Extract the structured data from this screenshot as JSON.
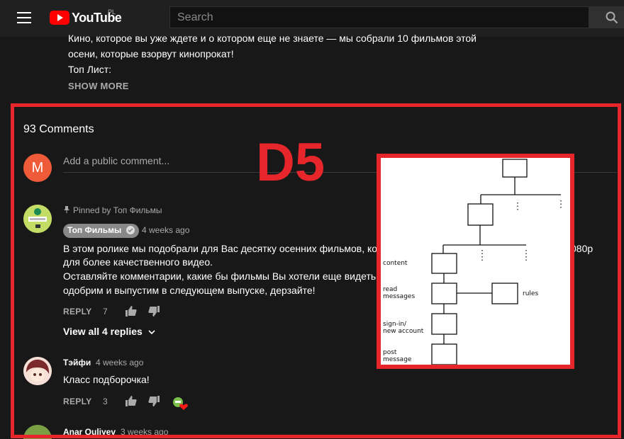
{
  "header": {
    "logo_text": "YouTube",
    "logo_region": "PL",
    "search_placeholder": "Search"
  },
  "description": {
    "line1": "Кино, которое вы уже ждете и о котором еще не знаете — мы собрали 10 фильмов этой",
    "line2": "осени, которые взорвут кинопрокат!",
    "line3": "Топ Лист:",
    "show_more": "SHOW MORE"
  },
  "annotation": {
    "label": "D5",
    "color": "#e6262b"
  },
  "comments": {
    "count_label": "93 Comments",
    "my_avatar_letter": "M",
    "add_placeholder": "Add a public comment...",
    "items": [
      {
        "pinned_label": "Pinned by Топ Фильмы",
        "author": "Топ Фильмы",
        "verified": true,
        "time": "4 weeks ago",
        "lines": [
          "В этом ролике мы подобрали для Вас десятку осенних фильмов, ко",
          "для более качественного видео.",
          "Оставляйте комментарии, какие бы фильмы Вы хотели еще видеть",
          "одобрим и выпустим в следующем выпуске, дерзайте!"
        ],
        "line_tail": "080р",
        "reply_label": "REPLY",
        "likes": "7",
        "view_replies": "View all 4 replies"
      },
      {
        "author": "Тэйфи",
        "time": "4 weeks ago",
        "lines": [
          "Класс подборочка!"
        ],
        "reply_label": "REPLY",
        "likes": "3",
        "creator_hearted": true
      },
      {
        "author": "Anar Quliyev",
        "time": "3 weeks ago"
      }
    ]
  },
  "sketch": {
    "labels": {
      "content": "content",
      "read_messages_1": "read",
      "read_messages_2": "messages",
      "rules": "rules",
      "sign_in_1": "sign-in/",
      "sign_in_2": "new account",
      "post_message_1": "post",
      "post_message_2": "message"
    }
  },
  "icons": {
    "menu": "hamburger-icon",
    "search": "search-icon",
    "pin": "pin-icon",
    "verified": "check-icon",
    "like": "thumb-up-icon",
    "dislike": "thumb-down-icon",
    "chevron": "chevron-down-icon",
    "heart": "heart-icon"
  }
}
